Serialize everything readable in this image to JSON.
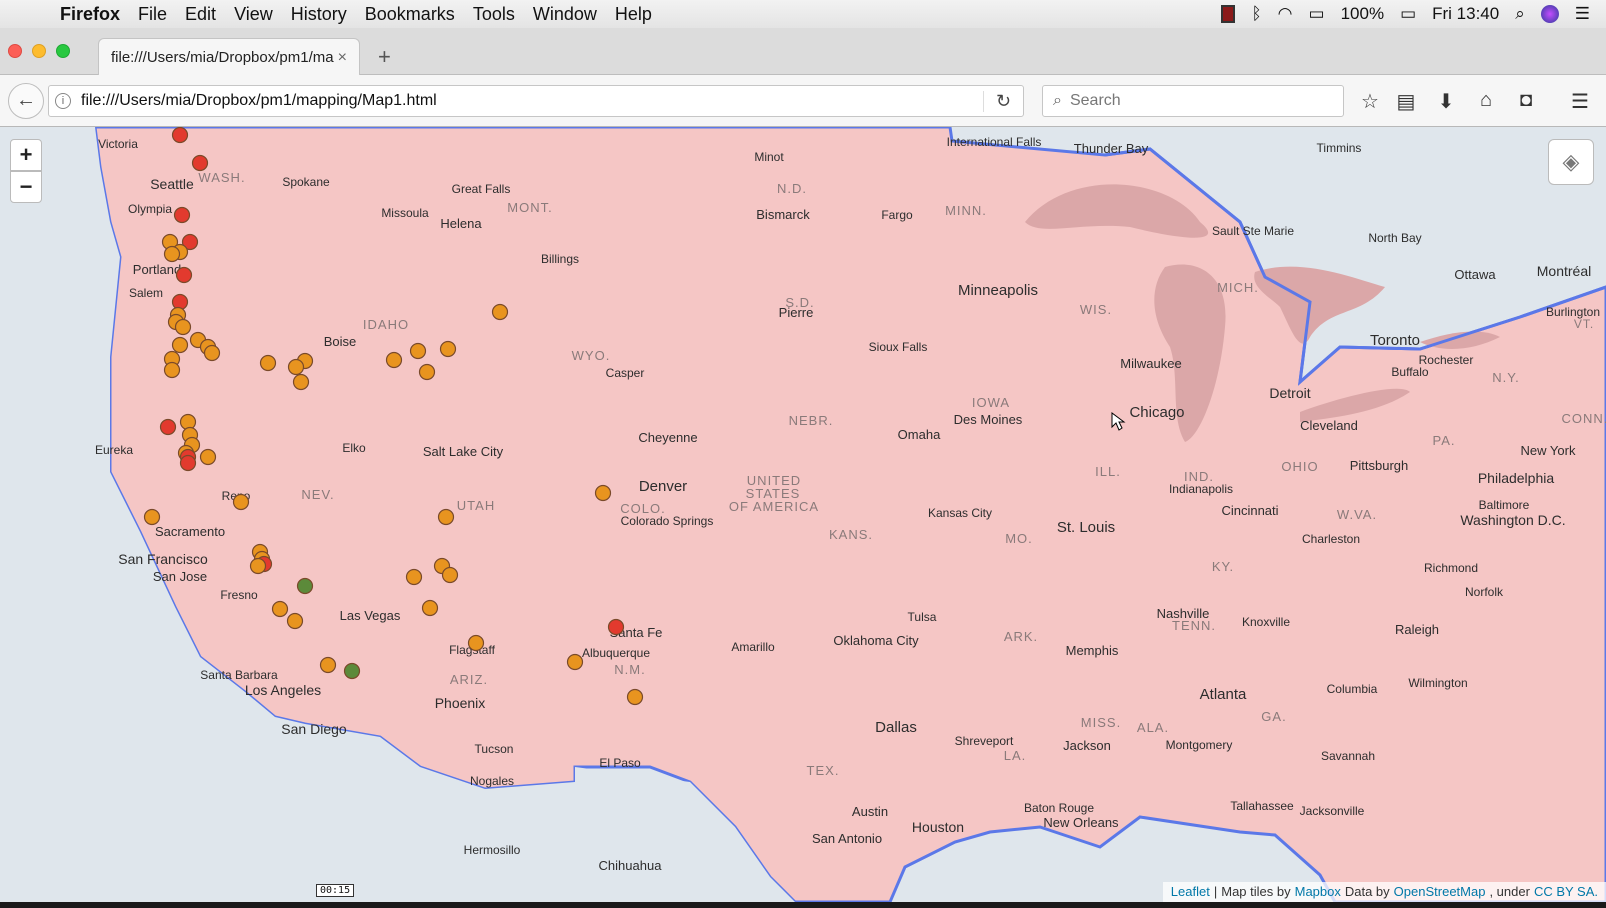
{
  "menubar": {
    "app": "Firefox",
    "items": [
      "File",
      "Edit",
      "View",
      "History",
      "Bookmarks",
      "Tools",
      "Window",
      "Help"
    ],
    "battery": "100%",
    "clock": "Fri 13:40"
  },
  "tab": {
    "title": "file:///Users/mia/Dropbox/pm1/ma",
    "close": "×"
  },
  "nav": {
    "url": "file:///Users/mia/Dropbox/pm1/mapping/Map1.html",
    "search_placeholder": "Search"
  },
  "map": {
    "zoom_in": "+",
    "zoom_out": "−",
    "labels": [
      [
        "Victoria",
        118,
        21,
        12,
        "city"
      ],
      [
        "Seattle",
        172,
        62,
        14,
        "city"
      ],
      [
        "WASH.",
        222,
        55,
        13,
        "state"
      ],
      [
        "Spokane",
        306,
        59,
        12,
        "city"
      ],
      [
        "Olympia",
        150,
        86,
        12,
        "city"
      ],
      [
        "Portland",
        157,
        147,
        13,
        "city"
      ],
      [
        "Salem",
        146,
        170,
        12,
        "city"
      ],
      [
        "Great Falls",
        481,
        66,
        12,
        "city"
      ],
      [
        "Missoula",
        405,
        90,
        12,
        "city"
      ],
      [
        "Helena",
        461,
        101,
        13,
        "city"
      ],
      [
        "MONT.",
        530,
        85,
        13,
        "state"
      ],
      [
        "Billings",
        560,
        136,
        12,
        "city"
      ],
      [
        "Minot",
        769,
        34,
        12,
        "city"
      ],
      [
        "N.D.",
        792,
        66,
        13,
        "state"
      ],
      [
        "Bismarck",
        783,
        92,
        13,
        "city"
      ],
      [
        "Fargo",
        897,
        92,
        12,
        "city"
      ],
      [
        "MINN.",
        966,
        88,
        13,
        "state"
      ],
      [
        "International Falls",
        994,
        19,
        12,
        "city"
      ],
      [
        "Thunder Bay",
        1111,
        26,
        13,
        "city"
      ],
      [
        "Timmins",
        1339,
        25,
        12,
        "city"
      ],
      [
        "Sault Ste Marie",
        1253,
        108,
        12,
        "city"
      ],
      [
        "North Bay",
        1395,
        115,
        12,
        "city"
      ],
      [
        "Ottawa",
        1475,
        152,
        13,
        "city"
      ],
      [
        "Montréal",
        1564,
        149,
        14,
        "city"
      ],
      [
        "Burlington",
        1573,
        189,
        12,
        "city"
      ],
      [
        "VT.",
        1584,
        201,
        12,
        "state"
      ],
      [
        "Minneapolis",
        998,
        168,
        15,
        "city"
      ],
      [
        "WIS.",
        1096,
        187,
        13,
        "state"
      ],
      [
        "MICH.",
        1238,
        165,
        13,
        "state"
      ],
      [
        "S.D.",
        800,
        180,
        13,
        "state"
      ],
      [
        "Pierre",
        796,
        190,
        13,
        "city"
      ],
      [
        "IDAHO",
        386,
        202,
        13,
        "state"
      ],
      [
        "Boise",
        340,
        219,
        13,
        "city"
      ],
      [
        "WYO.",
        591,
        233,
        13,
        "state"
      ],
      [
        "Casper",
        625,
        250,
        12,
        "city"
      ],
      [
        "Sioux Falls",
        898,
        224,
        12,
        "city"
      ],
      [
        "Toronto",
        1395,
        218,
        15,
        "city"
      ],
      [
        "Rochester",
        1446,
        237,
        12,
        "city"
      ],
      [
        "Buffalo",
        1410,
        249,
        12,
        "city"
      ],
      [
        "N.Y.",
        1506,
        255,
        13,
        "state"
      ],
      [
        "Milwaukee",
        1151,
        241,
        13,
        "city"
      ],
      [
        "Detroit",
        1290,
        271,
        14,
        "city"
      ],
      [
        "IOWA",
        991,
        280,
        13,
        "state"
      ],
      [
        "Des Moines",
        988,
        297,
        13,
        "city"
      ],
      [
        "Chicago",
        1157,
        290,
        15,
        "city"
      ],
      [
        "NEBR.",
        811,
        298,
        13,
        "state"
      ],
      [
        "Omaha",
        919,
        312,
        13,
        "city"
      ],
      [
        "Cleveland",
        1329,
        303,
        13,
        "city"
      ],
      [
        "PA.",
        1444,
        318,
        13,
        "state"
      ],
      [
        "CONN.",
        1585,
        296,
        13,
        "state"
      ],
      [
        "New York",
        1548,
        328,
        13,
        "city"
      ],
      [
        "Eureka",
        114,
        327,
        12,
        "city"
      ],
      [
        "Elko",
        354,
        325,
        12,
        "city"
      ],
      [
        "Salt Lake City",
        463,
        329,
        13,
        "city"
      ],
      [
        "Cheyenne",
        668,
        315,
        13,
        "city"
      ],
      [
        "ILL.",
        1108,
        349,
        13,
        "state"
      ],
      [
        "OHIO",
        1300,
        344,
        13,
        "state"
      ],
      [
        "Pittsburgh",
        1379,
        343,
        13,
        "city"
      ],
      [
        "Philadelphia",
        1516,
        356,
        14,
        "city"
      ],
      [
        "UNITED",
        774,
        358,
        13,
        "state"
      ],
      [
        "STATES",
        773,
        371,
        13,
        "state"
      ],
      [
        "OF AMERICA",
        774,
        384,
        13,
        "state"
      ],
      [
        "IND.",
        1199,
        354,
        13,
        "state"
      ],
      [
        "Indianapolis",
        1201,
        366,
        12,
        "city"
      ],
      [
        "NEV.",
        318,
        372,
        13,
        "state"
      ],
      [
        "Denver",
        663,
        364,
        15,
        "city"
      ],
      [
        "COLO.",
        643,
        386,
        13,
        "state"
      ],
      [
        "Colorado Springs",
        667,
        398,
        12,
        "city"
      ],
      [
        "UTAH",
        476,
        383,
        13,
        "state"
      ],
      [
        "Reno",
        236,
        373,
        12,
        "city"
      ],
      [
        "Sacramento",
        190,
        409,
        13,
        "city"
      ],
      [
        "Cincinnati",
        1250,
        388,
        13,
        "city"
      ],
      [
        "Baltimore",
        1504,
        382,
        12,
        "city"
      ],
      [
        "Washington D.C.",
        1513,
        398,
        14,
        "city"
      ],
      [
        "W.VA.",
        1357,
        392,
        13,
        "state"
      ],
      [
        "Charleston",
        1331,
        416,
        12,
        "city"
      ],
      [
        "Kansas City",
        960,
        390,
        12,
        "city"
      ],
      [
        "KANS.",
        851,
        412,
        13,
        "state"
      ],
      [
        "MO.",
        1019,
        416,
        13,
        "state"
      ],
      [
        "St. Louis",
        1086,
        405,
        15,
        "city"
      ],
      [
        "San Francisco",
        163,
        437,
        14,
        "city"
      ],
      [
        "San Jose",
        180,
        454,
        13,
        "city"
      ],
      [
        "KY.",
        1223,
        444,
        13,
        "state"
      ],
      [
        "Richmond",
        1451,
        445,
        12,
        "city"
      ],
      [
        "Fresno",
        239,
        472,
        12,
        "city"
      ],
      [
        "Las Vegas",
        370,
        493,
        13,
        "city"
      ],
      [
        "Norfolk",
        1484,
        469,
        12,
        "city"
      ],
      [
        "Tulsa",
        922,
        494,
        12,
        "city"
      ],
      [
        "Santa Fe",
        636,
        510,
        13,
        "city"
      ],
      [
        "Nashville",
        1183,
        491,
        13,
        "city"
      ],
      [
        "TENN.",
        1194,
        503,
        13,
        "state"
      ],
      [
        "Knoxville",
        1266,
        499,
        12,
        "city"
      ],
      [
        "Raleigh",
        1417,
        507,
        13,
        "city"
      ],
      [
        "Flagstaff",
        472,
        527,
        12,
        "city"
      ],
      [
        "Albuquerque",
        616,
        530,
        12,
        "city"
      ],
      [
        "N.M.",
        630,
        547,
        13,
        "state"
      ],
      [
        "Amarillo",
        753,
        524,
        12,
        "city"
      ],
      [
        "Oklahoma City",
        876,
        518,
        13,
        "city"
      ],
      [
        "ARK.",
        1021,
        514,
        13,
        "state"
      ],
      [
        "Memphis",
        1092,
        528,
        13,
        "city"
      ],
      [
        "Santa Barbara",
        239,
        552,
        12,
        "city"
      ],
      [
        "Los Angeles",
        283,
        568,
        14,
        "city"
      ],
      [
        "ARIZ.",
        469,
        557,
        13,
        "state"
      ],
      [
        "Phoenix",
        460,
        581,
        14,
        "city"
      ],
      [
        "Columbia",
        1352,
        566,
        12,
        "city"
      ],
      [
        "Wilmington",
        1438,
        560,
        12,
        "city"
      ],
      [
        "Atlanta",
        1223,
        572,
        15,
        "city"
      ],
      [
        "GA.",
        1274,
        594,
        13,
        "state"
      ],
      [
        "San Diego",
        314,
        607,
        14,
        "city"
      ],
      [
        "Dallas",
        896,
        605,
        15,
        "city"
      ],
      [
        "Shreveport",
        984,
        618,
        12,
        "city"
      ],
      [
        "LA.",
        1015,
        633,
        13,
        "state"
      ],
      [
        "MISS.",
        1101,
        600,
        13,
        "state"
      ],
      [
        "Jackson",
        1087,
        623,
        13,
        "city"
      ],
      [
        "ALA.",
        1153,
        605,
        13,
        "state"
      ],
      [
        "Montgomery",
        1199,
        622,
        12,
        "city"
      ],
      [
        "Savannah",
        1348,
        633,
        12,
        "city"
      ],
      [
        "Tucson",
        494,
        626,
        12,
        "city"
      ],
      [
        "Nogales",
        492,
        658,
        12,
        "city"
      ],
      [
        "El Paso",
        620,
        640,
        12,
        "city"
      ],
      [
        "TEX.",
        823,
        648,
        13,
        "state"
      ],
      [
        "Baton Rouge",
        1059,
        685,
        12,
        "city"
      ],
      [
        "Tallahassee",
        1262,
        683,
        12,
        "city"
      ],
      [
        "Jacksonville",
        1332,
        688,
        12,
        "city"
      ],
      [
        "New Orleans",
        1081,
        700,
        13,
        "city"
      ],
      [
        "Austin",
        870,
        689,
        13,
        "city"
      ],
      [
        "Houston",
        938,
        705,
        14,
        "city"
      ],
      [
        "San Antonio",
        847,
        716,
        13,
        "city"
      ],
      [
        "Hermosillo",
        492,
        727,
        12,
        "city"
      ],
      [
        "Chihuahua",
        630,
        743,
        13,
        "city"
      ]
    ],
    "marker_colors": {
      "orange": "#e8941f",
      "red": "#e23a2e",
      "green": "#5c8a3a"
    },
    "attribution": {
      "leaflet": "Leaflet",
      "sep": "|",
      "tiles_text": "Map tiles by",
      "mapbox": "Mapbox",
      "data_text": "Data by",
      "osm": "OpenStreetMap",
      "under_text": ", under",
      "license": "CC BY SA."
    }
  },
  "video_timer": "00:15"
}
